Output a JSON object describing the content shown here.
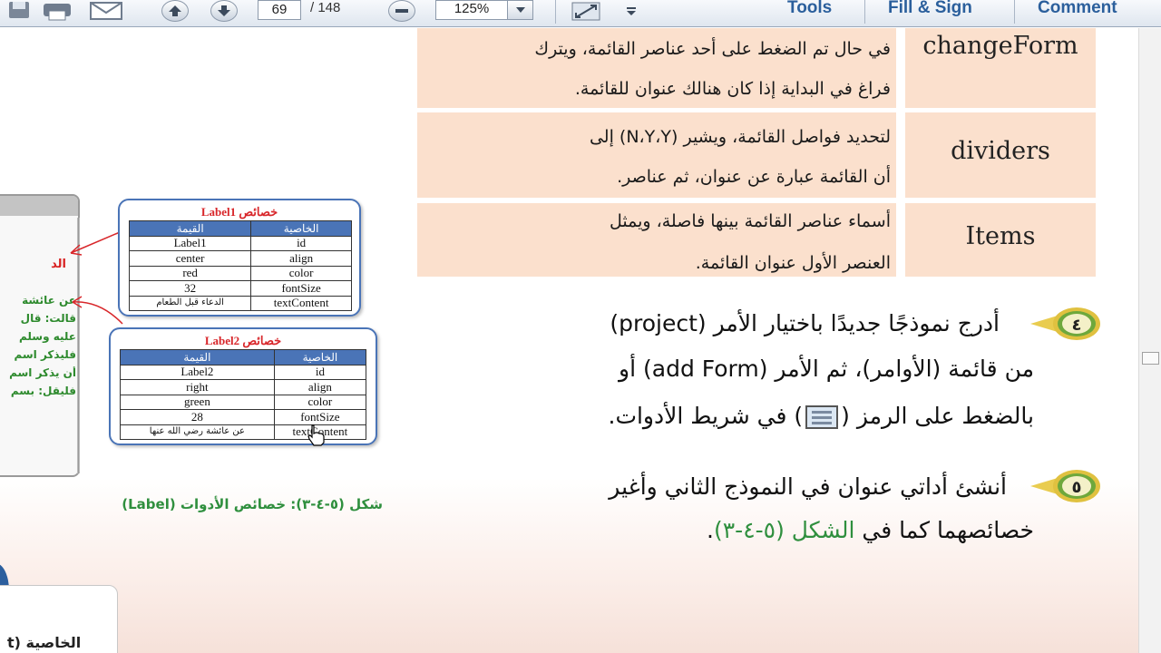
{
  "toolbar": {
    "page_current": "69",
    "page_total": "/ 148",
    "zoom": "125%",
    "tools_label": "Tools",
    "fill_sign_label": "Fill & Sign",
    "comment_label": "Comment"
  },
  "properties_table": {
    "rows": [
      {
        "name": "changeForm",
        "desc_line1": "في حال تم الضغط على أحد عناصر القائمة، ويترك",
        "desc_line2": "فراغ في البداية إذا كان هنالك عنوان للقائمة."
      },
      {
        "name": "dividers",
        "desc_line1": "لتحديد فواصل القائمة، ويشير (N،Y،Y) إلى",
        "desc_line2": "أن القائمة عبارة عن عنوان، ثم عناصر."
      },
      {
        "name": "Items",
        "desc_line1": "أسماء عناصر القائمة بينها فاصلة، ويمثل",
        "desc_line2": "العنصر الأول عنوان القائمة."
      }
    ]
  },
  "figure": {
    "label1_box": {
      "title": "خصائص Label1",
      "col_value": "القيمة",
      "col_property": "الخاصية",
      "rows": [
        {
          "value": "Label1",
          "property": "id"
        },
        {
          "value": "center",
          "property": "align"
        },
        {
          "value": "red",
          "property": "color"
        },
        {
          "value": "32",
          "property": "fontSize"
        },
        {
          "value": "الدعاء قبل الطعام",
          "property": "textContent"
        }
      ]
    },
    "label2_box": {
      "title": "خصائص Label2",
      "col_value": "القيمة",
      "col_property": "الخاصية",
      "rows": [
        {
          "value": "Label2",
          "property": "id"
        },
        {
          "value": "right",
          "property": "align"
        },
        {
          "value": "green",
          "property": "color"
        },
        {
          "value": "28",
          "property": "fontSize"
        },
        {
          "value": "عن عائشة رضي الله عنها",
          "property": "textContent"
        }
      ]
    },
    "panel_red_text": "الد",
    "panel_green_lines": [
      "عن عائشة",
      "قالت: قال",
      "عليه وسلم",
      "فليذكر اسم",
      "أن يذكر اسم",
      "فليقل: بسم"
    ],
    "caption": "شكل (٥-٤-٣): خصائص الأدوات (Label)"
  },
  "steps": [
    {
      "number": "٤",
      "line1": "أدرج نموذجًا جديدًا باختيار الأمر (project)",
      "line2": "من قائمة (الأوامر)، ثم الأمر (add Form) أو",
      "line3_part1": "بالضغط على الرمز (",
      "line3_part2": ") في شريط الأدوات."
    },
    {
      "number": "٥",
      "line1": "أنشئ أداتي عنوان في النموذج الثاني وأغير",
      "line2_part1": "خصائصهما كما في ",
      "line2_part2": "الشكل (٥-٤-٣)",
      "line2_part3": "."
    }
  ],
  "bottom": {
    "label": "الخاصية (t"
  },
  "colors": {
    "table_fill": "#fbe0cd",
    "accent_green": "#2f8f3e",
    "accent_red": "#d8262a",
    "box_blue": "#4a74b7",
    "toolbar_link": "#2b5f9c"
  }
}
